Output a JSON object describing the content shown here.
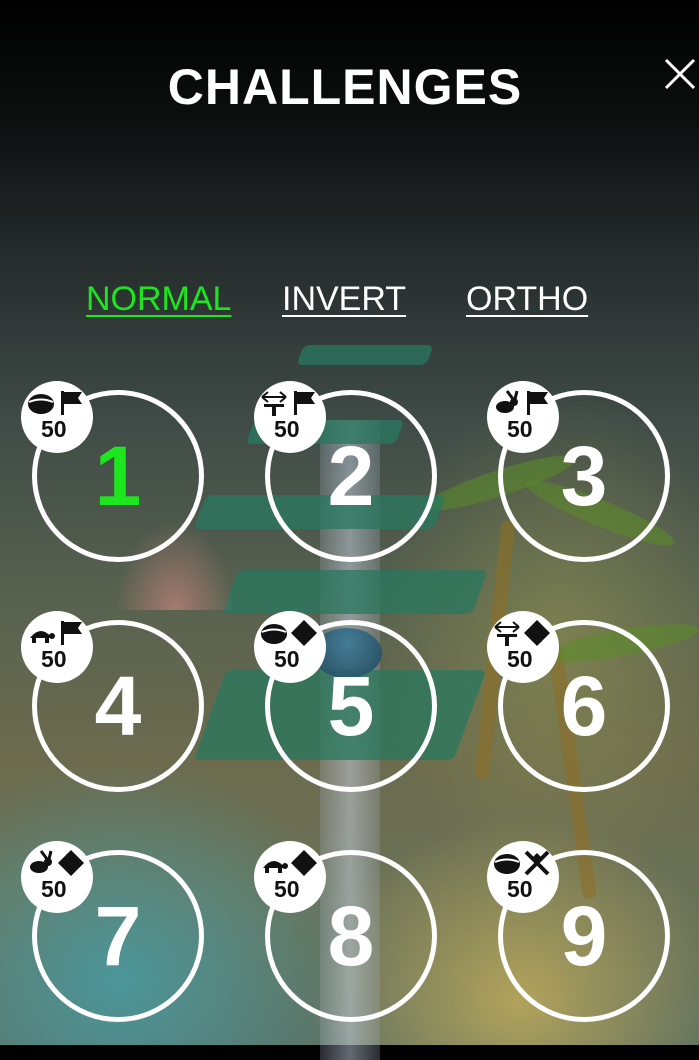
{
  "header": {
    "title": "CHALLENGES",
    "close_icon": "close-icon"
  },
  "tabs": [
    {
      "label": "NORMAL",
      "active": true
    },
    {
      "label": "INVERT",
      "active": false
    },
    {
      "label": "ORTHO",
      "active": false
    }
  ],
  "colors": {
    "active": "#1ee61e",
    "text": "#ffffff"
  },
  "levels": [
    {
      "number": "1",
      "score": "50",
      "completed": true,
      "icons": [
        "ball-icon",
        "flag-icon"
      ]
    },
    {
      "number": "2",
      "score": "50",
      "completed": false,
      "icons": [
        "width-arrow-icon",
        "flag-icon"
      ]
    },
    {
      "number": "3",
      "score": "50",
      "completed": false,
      "icons": [
        "rabbit-icon",
        "flag-icon"
      ]
    },
    {
      "number": "4",
      "score": "50",
      "completed": false,
      "icons": [
        "turtle-icon",
        "flag-icon"
      ]
    },
    {
      "number": "5",
      "score": "50",
      "completed": false,
      "icons": [
        "ball-icon",
        "diamond-icon"
      ]
    },
    {
      "number": "6",
      "score": "50",
      "completed": false,
      "icons": [
        "width-arrow-icon",
        "diamond-icon"
      ]
    },
    {
      "number": "7",
      "score": "50",
      "completed": false,
      "icons": [
        "rabbit-icon",
        "diamond-icon"
      ]
    },
    {
      "number": "8",
      "score": "50",
      "completed": false,
      "icons": [
        "turtle-icon",
        "diamond-icon"
      ]
    },
    {
      "number": "9",
      "score": "50",
      "completed": false,
      "icons": [
        "ball-icon",
        "crossed-arrows-icon"
      ]
    }
  ]
}
